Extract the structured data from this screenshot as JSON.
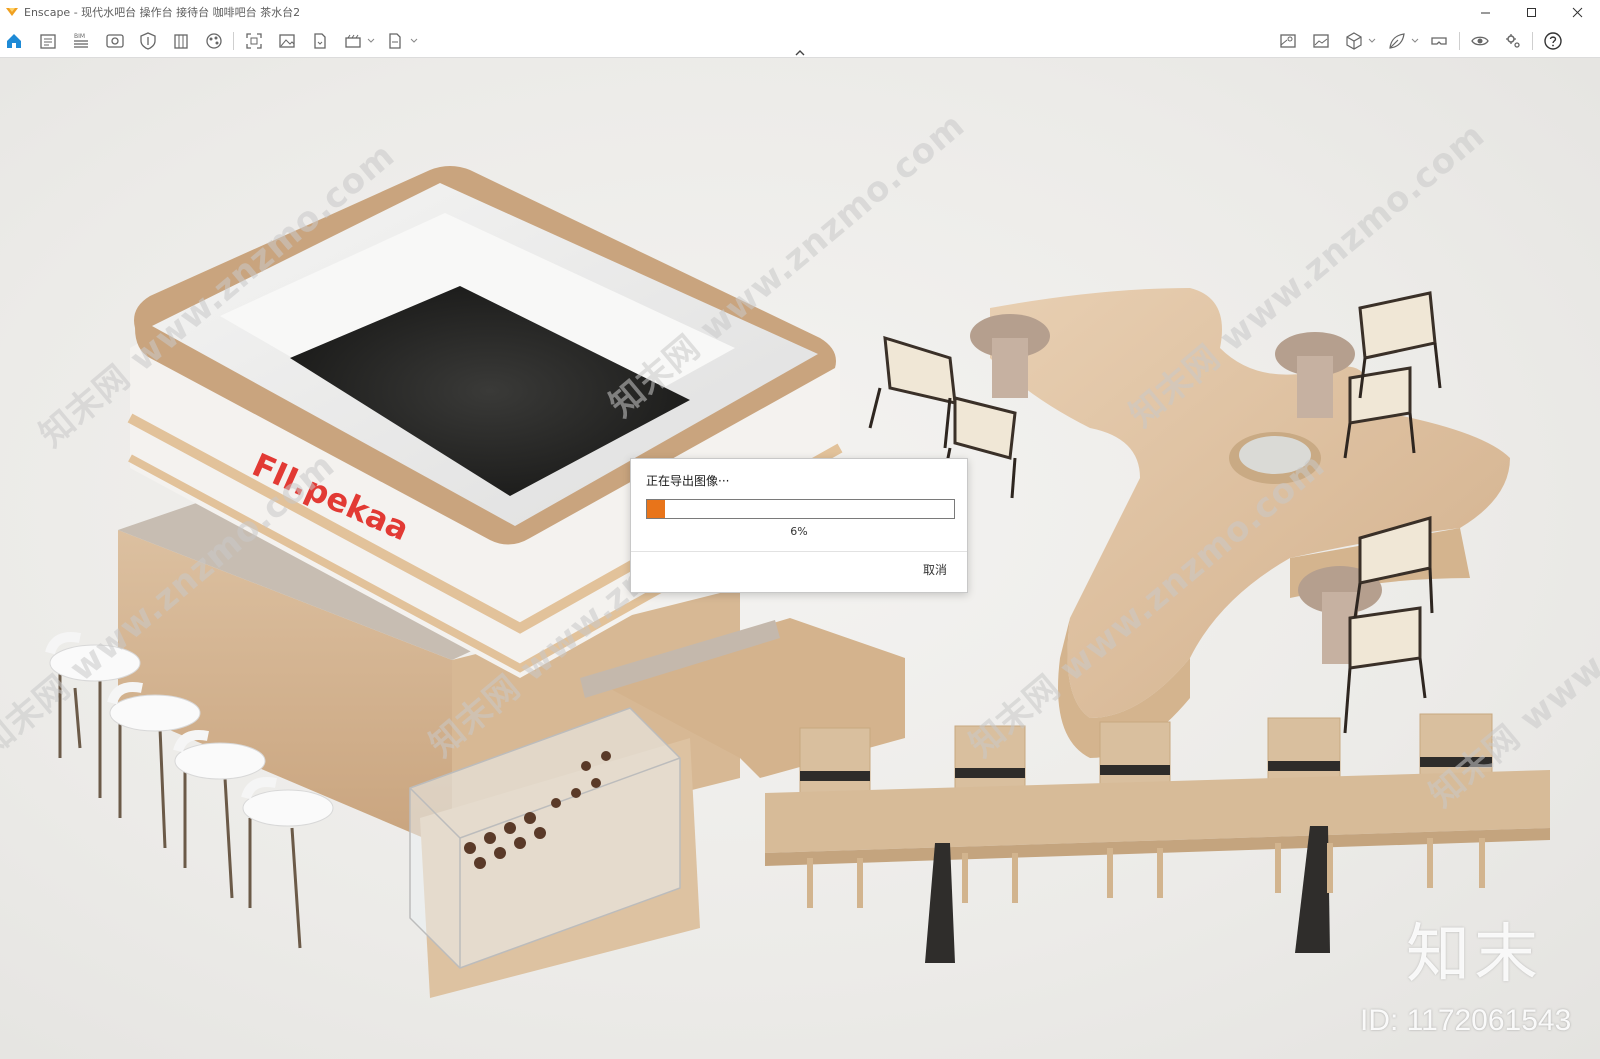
{
  "window": {
    "title": "Enscape - 现代水吧台 操作台 接待台 咖啡吧台 茶水台2",
    "minimize_icon": "minimize-icon",
    "maximize_icon": "maximize-icon",
    "close_icon": "close-icon"
  },
  "toolbar": {
    "left_icons": [
      "home-icon",
      "document-icon",
      "bim-icon",
      "view-icon",
      "shield-icon",
      "building-icon",
      "materials-icon",
      "capture-icon",
      "image-icon",
      "export-icon",
      "batch-render-icon",
      "exe-export-icon"
    ],
    "right_icons": [
      "map-icon",
      "gallery-icon",
      "cube-icon",
      "leaf-icon",
      "vr-icon",
      "eye-icon",
      "settings-icon",
      "help-icon"
    ],
    "bim_label": "BIM",
    "accent": "#1e8ad6"
  },
  "dialog": {
    "title": "正在导出图像···",
    "progress_percent": 6,
    "progress_text": "6%",
    "cancel_label": "取消",
    "progress_color": "#e8741a"
  },
  "scene": {
    "sign_text": "FII.pekaa"
  },
  "watermark": {
    "text": "知末网 www.znzmo.com",
    "logo": "知末",
    "id": "ID: 1172061543"
  }
}
